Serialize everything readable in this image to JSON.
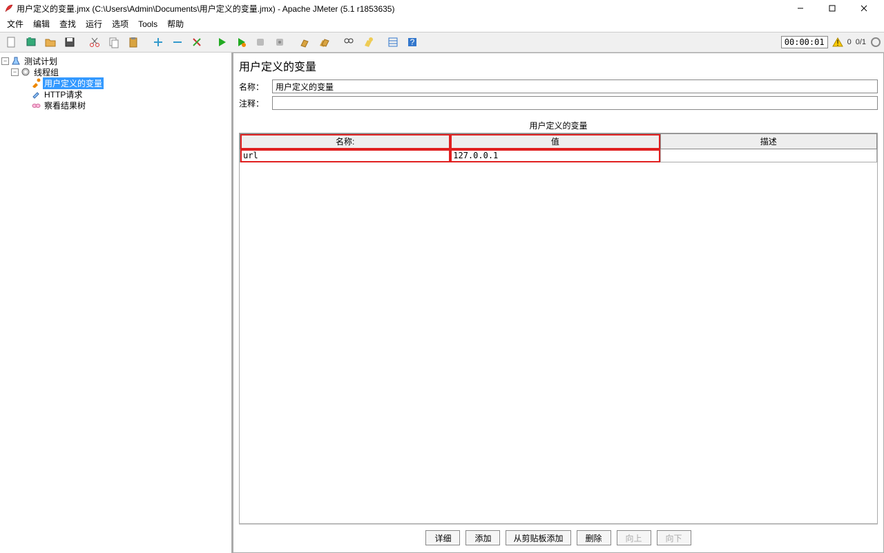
{
  "window": {
    "title": "用户定义的变量.jmx (C:\\Users\\Admin\\Documents\\用户定义的变量.jmx) - Apache JMeter (5.1 r1853635)"
  },
  "menu": {
    "items": [
      "文件",
      "编辑",
      "查找",
      "运行",
      "选项",
      "Tools",
      "帮助"
    ]
  },
  "toolbar": {
    "elapsed": "00:00:01",
    "active_threads": "0",
    "total_threads": "0/1"
  },
  "tree": {
    "nodes": [
      {
        "label": "测试计划",
        "depth": 0,
        "expanded": true,
        "icon": "beaker"
      },
      {
        "label": "线程组",
        "depth": 1,
        "expanded": true,
        "icon": "gear"
      },
      {
        "label": "用户定义的变量",
        "depth": 2,
        "icon": "wrench",
        "selected": true
      },
      {
        "label": "HTTP请求",
        "depth": 2,
        "icon": "dropper"
      },
      {
        "label": "察看结果树",
        "depth": 2,
        "icon": "goggles"
      }
    ]
  },
  "panel": {
    "title": "用户定义的变量",
    "name_label": "名称：",
    "name_value": "用户定义的变量",
    "comment_label": "注释：",
    "comment_value": "",
    "vars_section_label": "用户定义的变量",
    "columns": {
      "name": "名称:",
      "value": "值",
      "desc": "描述"
    },
    "rows": [
      {
        "name": "url",
        "value": "127.0.0.1",
        "desc": ""
      }
    ],
    "buttons": {
      "detail": "详细",
      "add": "添加",
      "add_clipboard": "从剪贴板添加",
      "delete": "删除",
      "up": "向上",
      "down": "向下"
    }
  }
}
